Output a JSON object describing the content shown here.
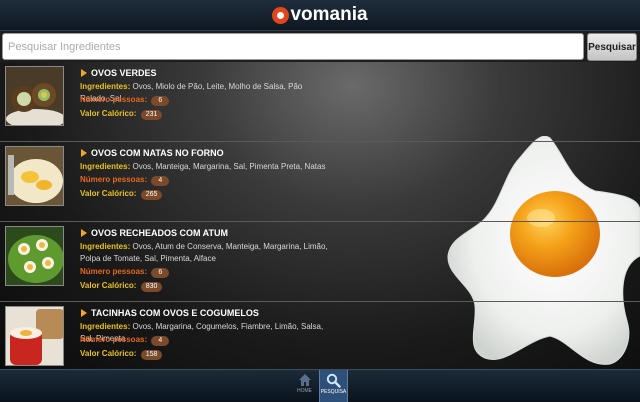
{
  "header": {
    "logo_letter": "O",
    "logo_rest": "vomania"
  },
  "search": {
    "placeholder": "Pesquisar Ingredientes",
    "value": "",
    "button_label": "Pesquisar"
  },
  "labels": {
    "ingredients": "Ingredientes:",
    "people": "Número pessoas:",
    "calories": "Valor Calórico:"
  },
  "recipes": [
    {
      "title": "OVOS VERDES",
      "ingredients": "Ovos, Miolo de Pão, Leite, Molho de Salsa, Pão Ralado, Sal",
      "people": "6",
      "calories": "231"
    },
    {
      "title": "OVOS COM NATAS NO FORNO",
      "ingredients": "Ovos, Manteiga, Margarina, Sal, Pimenta Preta, Natas",
      "people": "4",
      "calories": "265"
    },
    {
      "title": "OVOS RECHEADOS COM ATUM",
      "ingredients": "Ovos, Atum de Conserva, Manteiga, Margarina, Limão, Polpa de Tomate, Sal, Pimenta, Alface",
      "people": "6",
      "calories": "830"
    },
    {
      "title": "TACINHAS COM OVOS E COGUMELOS",
      "ingredients": "Ovos, Margarina, Cogumelos, Fiambre, Limão, Salsa, Sal, Pimenta",
      "people": "4",
      "calories": "158"
    }
  ],
  "footer": {
    "tabs": [
      {
        "label": "HOME",
        "icon": "home-icon"
      },
      {
        "label": "PESQUISA",
        "icon": "search-icon"
      }
    ]
  },
  "colors": {
    "accent": "#e2471b",
    "ingredient_label": "#e8c21e",
    "people_label": "#e7671e",
    "badge": "#7a4a2a",
    "active_tab": "#2d4f78"
  }
}
